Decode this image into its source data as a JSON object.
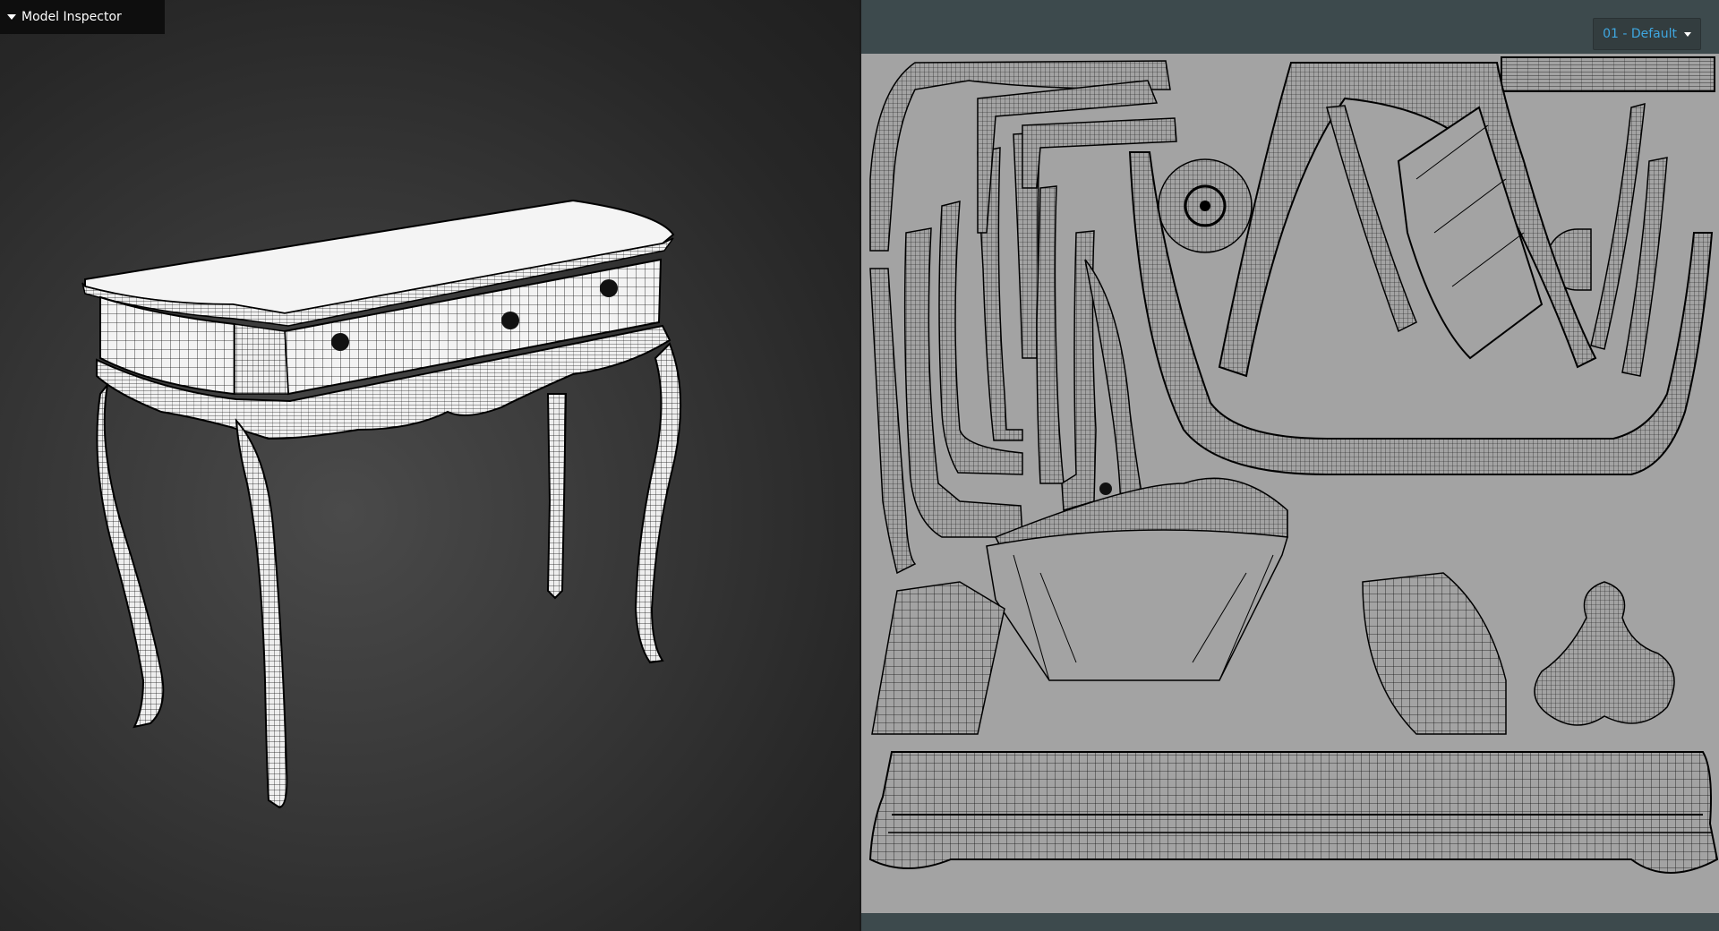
{
  "inspector": {
    "title": "Model Inspector"
  },
  "uv_editor": {
    "material_selected": "01 - Default"
  },
  "colors": {
    "inspector_bg": "#0e0e0e",
    "uv_background": "#a3a3a3",
    "uv_panel_bg": "#3d4a4d",
    "dropdown_text": "#3fa7e0",
    "wire": "#000000",
    "model_surface": "#f2f2f2"
  },
  "icons": {
    "inspector_toggle": "caret-down-icon",
    "dropdown_toggle": "chevron-down-icon"
  }
}
